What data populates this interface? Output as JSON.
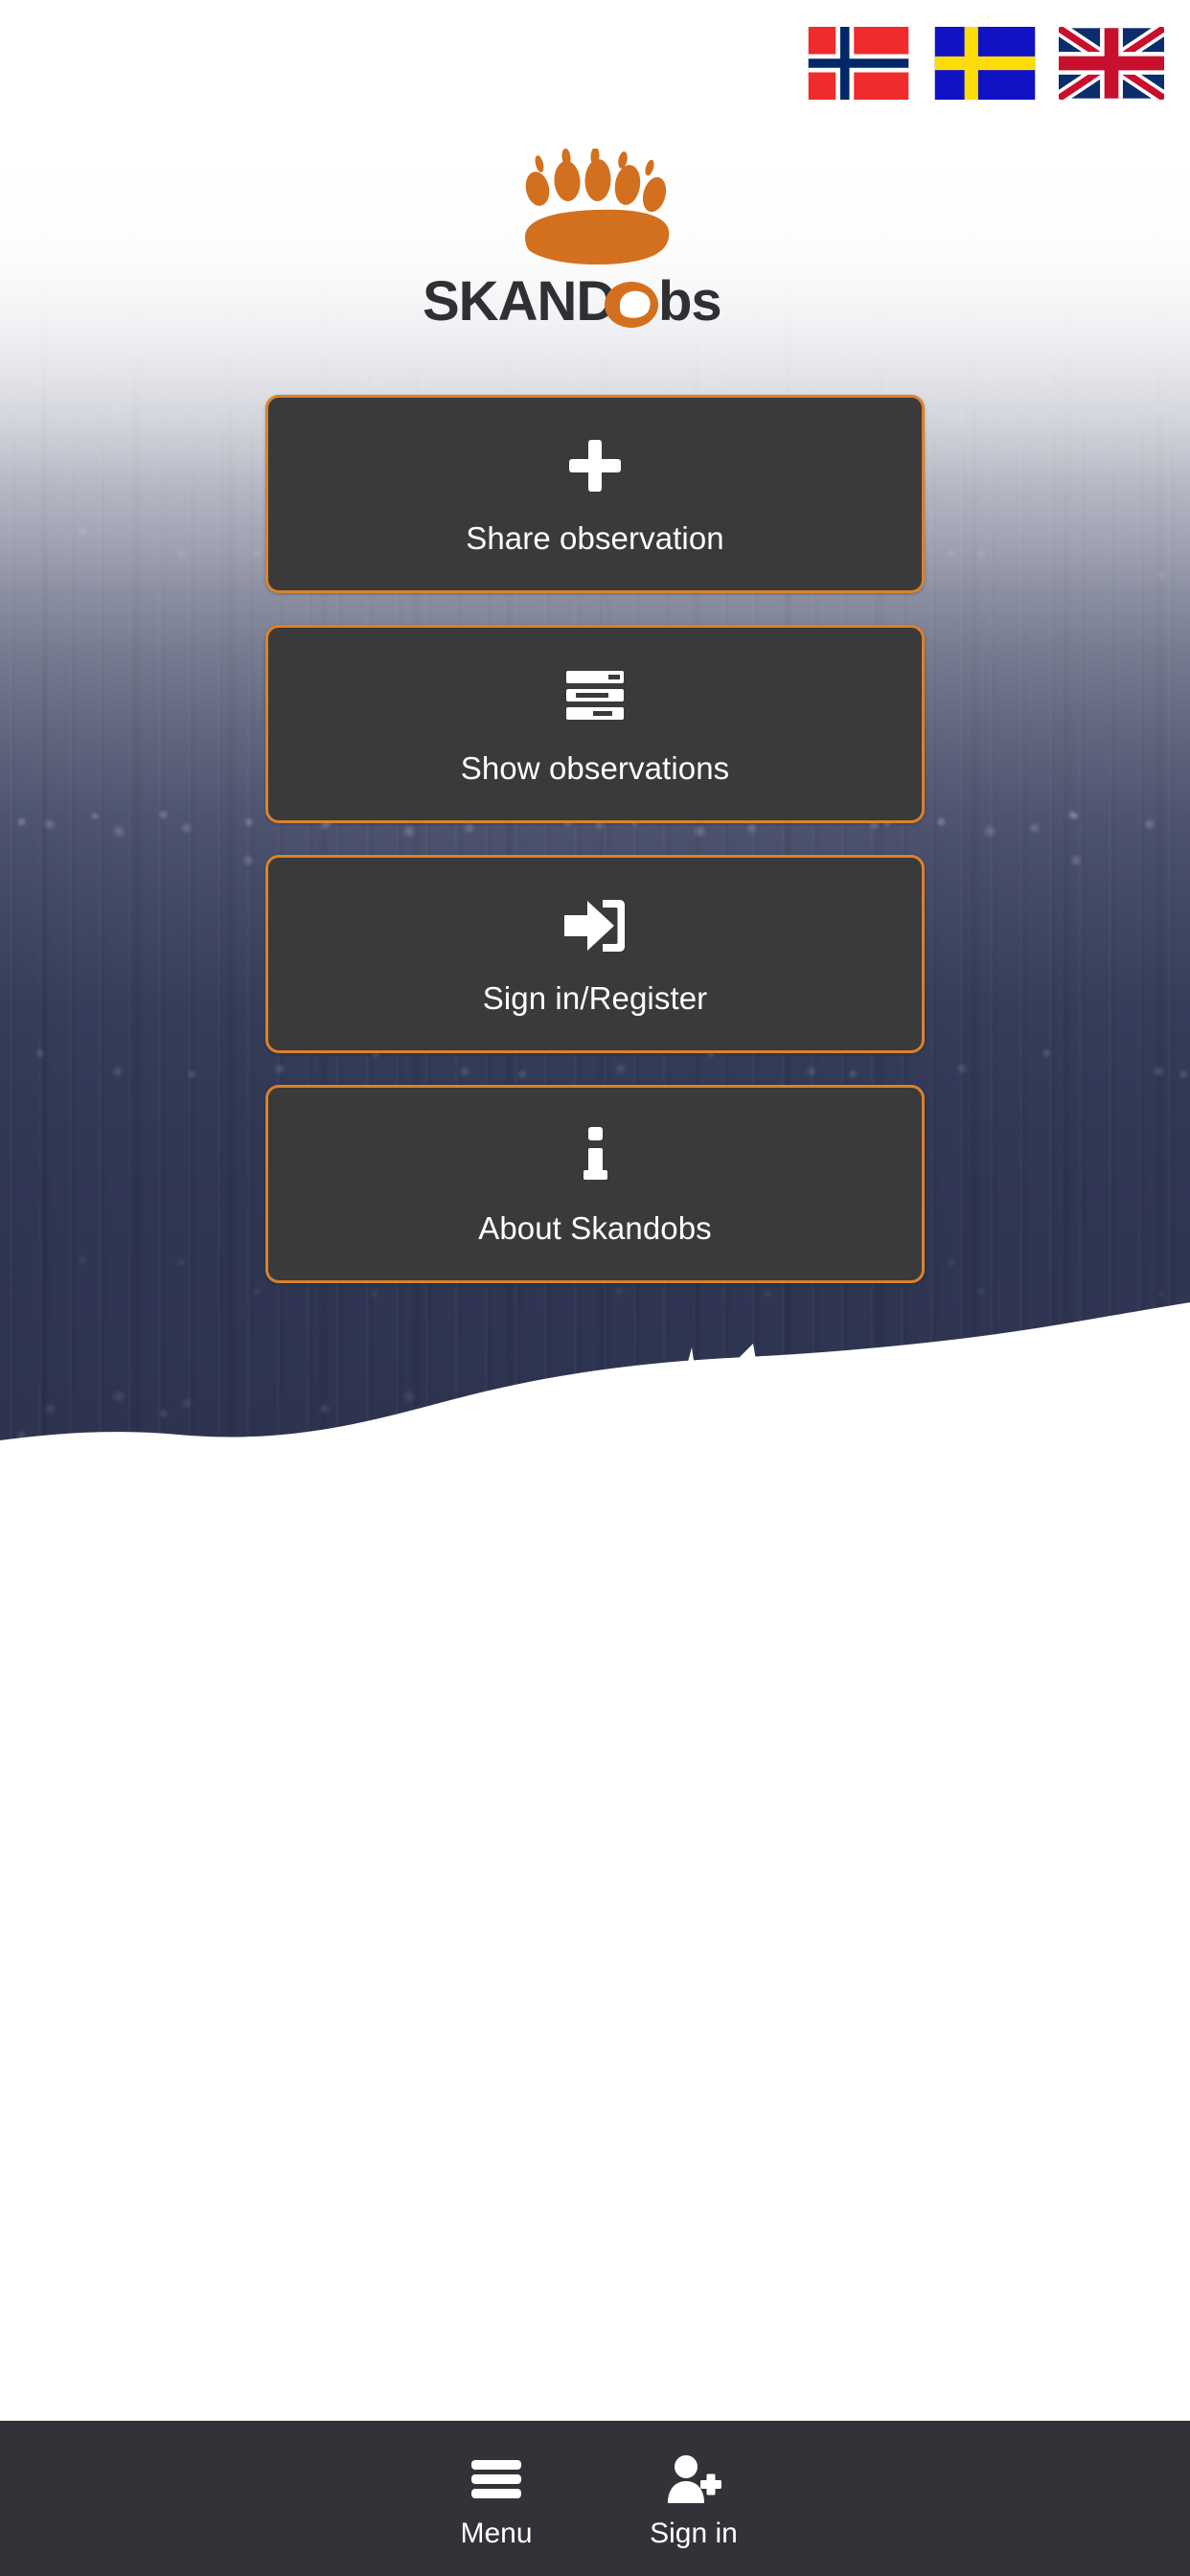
{
  "app": {
    "name": "SKANDobs",
    "brand_word_dark": "SKAND",
    "brand_word_o": "O",
    "brand_word_tail": "bs"
  },
  "colors": {
    "accent_orange": "#d9822b",
    "logo_orange": "#d2701f",
    "card_background": "#3a3a3a",
    "card_text": "#ffffff",
    "nav_background": "#323338",
    "page_background": "#ffffff",
    "logo_text_dark": "#2f3033"
  },
  "language_bar": {
    "items": [
      {
        "code": "no",
        "label": "Norsk",
        "icon": "flag-norway-icon"
      },
      {
        "code": "sv",
        "label": "Svenska",
        "icon": "flag-sweden-icon"
      },
      {
        "code": "en",
        "label": "English",
        "icon": "flag-united-kingdom-icon"
      }
    ]
  },
  "logo": {
    "paw_icon": "bear-paw-icon",
    "alt": "SKANDobs"
  },
  "main": {
    "cards": [
      {
        "id": "share-observation",
        "label": "Share observation",
        "icon": "plus-icon"
      },
      {
        "id": "show-observations",
        "label": "Show observations",
        "icon": "list-icon"
      },
      {
        "id": "sign-in-register",
        "label": "Sign in/Register",
        "icon": "sign-in-icon"
      },
      {
        "id": "about-skandobs",
        "label": "About Skandobs",
        "icon": "info-icon"
      }
    ]
  },
  "hero": {
    "scene": "winter-forest-photo",
    "animal_silhouette": "lynx-silhouette"
  },
  "bottom_nav": {
    "items": [
      {
        "id": "menu",
        "label": "Menu",
        "icon": "hamburger-menu-icon"
      },
      {
        "id": "sign-in",
        "label": "Sign in",
        "icon": "user-plus-icon"
      }
    ]
  }
}
